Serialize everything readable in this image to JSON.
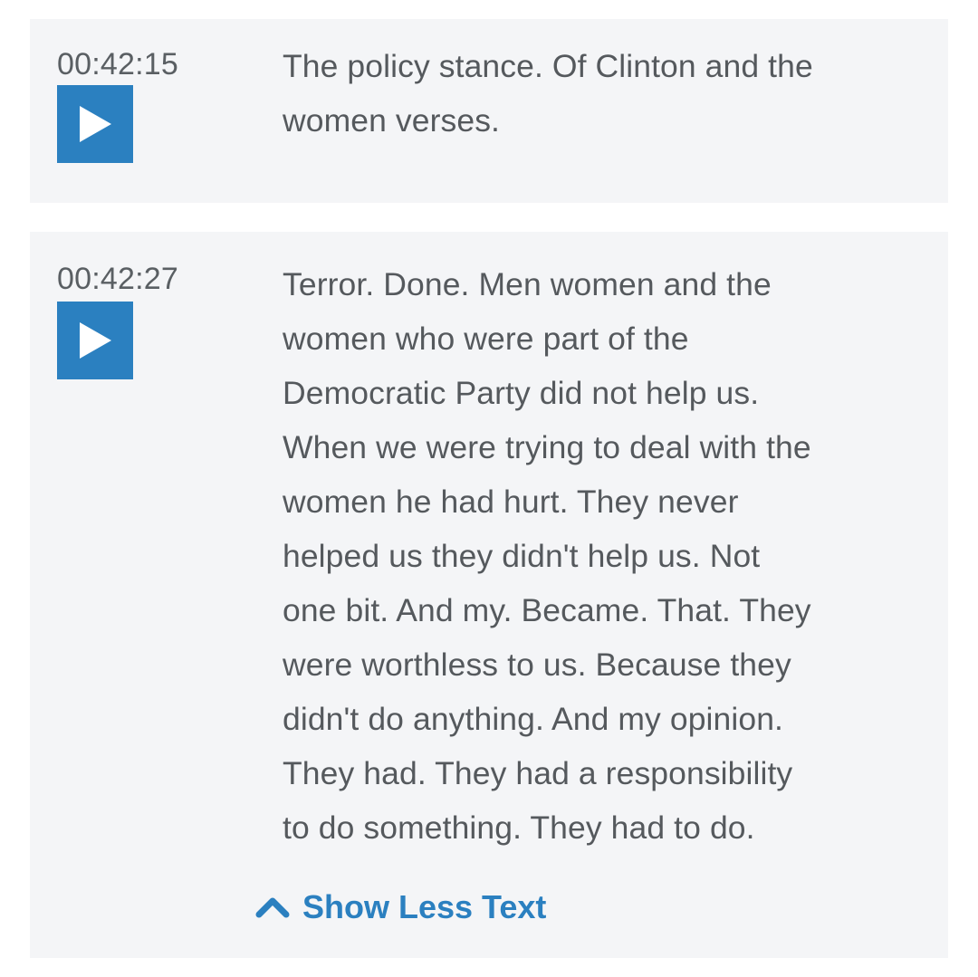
{
  "colors": {
    "accent": "#2b80c0",
    "card_background": "#f4f5f7",
    "text": "#55595d"
  },
  "transcript_entries": [
    {
      "timestamp": "00:42:15",
      "play_icon": "play-icon",
      "lines": [
        "The policy stance. Of Clinton and the",
        "women verses."
      ]
    },
    {
      "timestamp": "00:42:27",
      "play_icon": "play-icon",
      "lines": [
        "Terror. Done. Men women and the",
        "women who were part of the",
        "Democratic Party did not help us.",
        "When we were trying to deal with the",
        "women he had hurt. They never",
        "helped us they didn't help us. Not",
        "one bit. And my. Became. That. They",
        "were worthless to us. Because they",
        "didn't do anything. And my opinion.",
        "They had. They had a responsibility",
        "to do something. They had to do."
      ],
      "toggle": {
        "icon": "chevron-up-icon",
        "label": "Show Less Text"
      }
    }
  ]
}
